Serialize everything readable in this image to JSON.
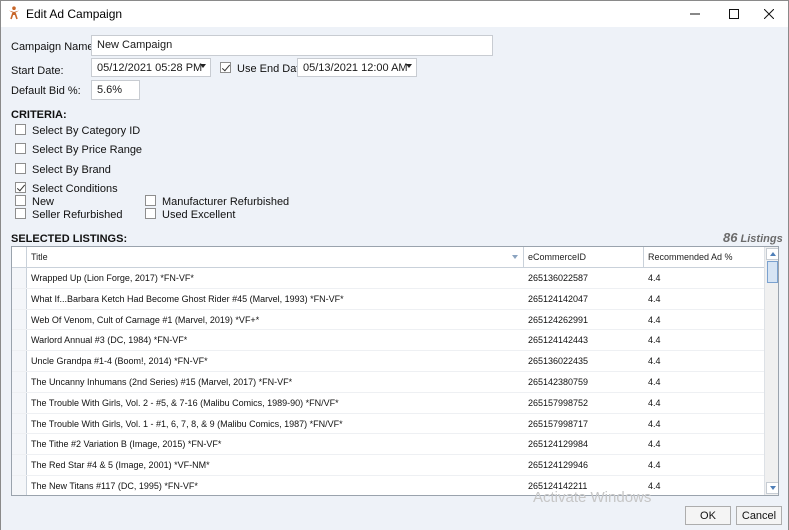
{
  "window": {
    "title": "Edit Ad Campaign"
  },
  "form": {
    "campaign_name_label": "Campaign Name:",
    "campaign_name_value": "New Campaign",
    "start_date_label": "Start Date:",
    "start_date_value": "05/12/2021 05:28 PM",
    "use_end_date_label": "Use End Date",
    "use_end_date_checked": true,
    "end_date_value": "05/13/2021 12:00 AM",
    "default_bid_label": "Default Bid %:",
    "default_bid_value": "5.6%"
  },
  "criteria": {
    "heading": "CRITERIA:",
    "category": {
      "label": "Select By Category ID",
      "checked": false
    },
    "price": {
      "label": "Select By Price Range",
      "checked": false
    },
    "brand": {
      "label": "Select By Brand",
      "checked": false
    },
    "conditions": {
      "label": "Select Conditions",
      "checked": true
    },
    "cond_new": {
      "label": "New",
      "checked": false
    },
    "cond_seller_refurb": {
      "label": "Seller Refurbished",
      "checked": false
    },
    "cond_mfr_refurb": {
      "label": "Manufacturer Refurbished",
      "checked": false
    },
    "cond_used_excellent": {
      "label": "Used Excellent",
      "checked": false
    }
  },
  "listings": {
    "heading": "SELECTED LISTINGS:",
    "count": "86",
    "count_suffix": "Listings",
    "columns": {
      "title": "Title",
      "id": "eCommerceID",
      "rec": "Recommended Ad %"
    },
    "rows": [
      {
        "title": "Wrapped Up (Lion Forge, 2017) *FN-VF*",
        "id": "265136022587",
        "rec": "4.4"
      },
      {
        "title": "What If...Barbara Ketch Had Become Ghost Rider #45 (Marvel, 1993) *FN-VF*",
        "id": "265124142047",
        "rec": "4.4"
      },
      {
        "title": "Web Of Venom, Cult of Carnage #1 (Marvel, 2019) *VF+*",
        "id": "265124262991",
        "rec": "4.4"
      },
      {
        "title": "Warlord Annual #3 (DC, 1984) *FN-VF*",
        "id": "265124142443",
        "rec": "4.4"
      },
      {
        "title": "Uncle Grandpa #1-4 (Boom!, 2014) *FN-VF*",
        "id": "265136022435",
        "rec": "4.4"
      },
      {
        "title": "The Uncanny Inhumans (2nd Series) #15 (Marvel, 2017) *FN-VF*",
        "id": "265142380759",
        "rec": "4.4"
      },
      {
        "title": "The Trouble With Girls, Vol. 2 - #5, & 7-16 (Malibu Comics, 1989-90) *FN/VF*",
        "id": "265157998752",
        "rec": "4.4"
      },
      {
        "title": "The Trouble With Girls, Vol. 1 - #1, 6, 7, 8, & 9 (Malibu Comics, 1987) *FN/VF*",
        "id": "265157998717",
        "rec": "4.4"
      },
      {
        "title": "The Tithe #2 Variation B (Image, 2015) *FN-VF*",
        "id": "265124129984",
        "rec": "4.4"
      },
      {
        "title": "The Red Star #4 & 5 (Image, 2001) *VF-NM*",
        "id": "265124129946",
        "rec": "4.4"
      },
      {
        "title": "The New Titans #117 (DC, 1995) *FN-VF*",
        "id": "265124142211",
        "rec": "4.4"
      }
    ]
  },
  "buttons": {
    "ok": "OK",
    "cancel": "Cancel"
  },
  "watermark": "Activate Windows",
  "colors": {
    "window_bg": "#eef2f8",
    "grid_border": "#9aa3ad",
    "scroll_accent": "#4f7fb8",
    "app_icon": "#c8672a"
  }
}
